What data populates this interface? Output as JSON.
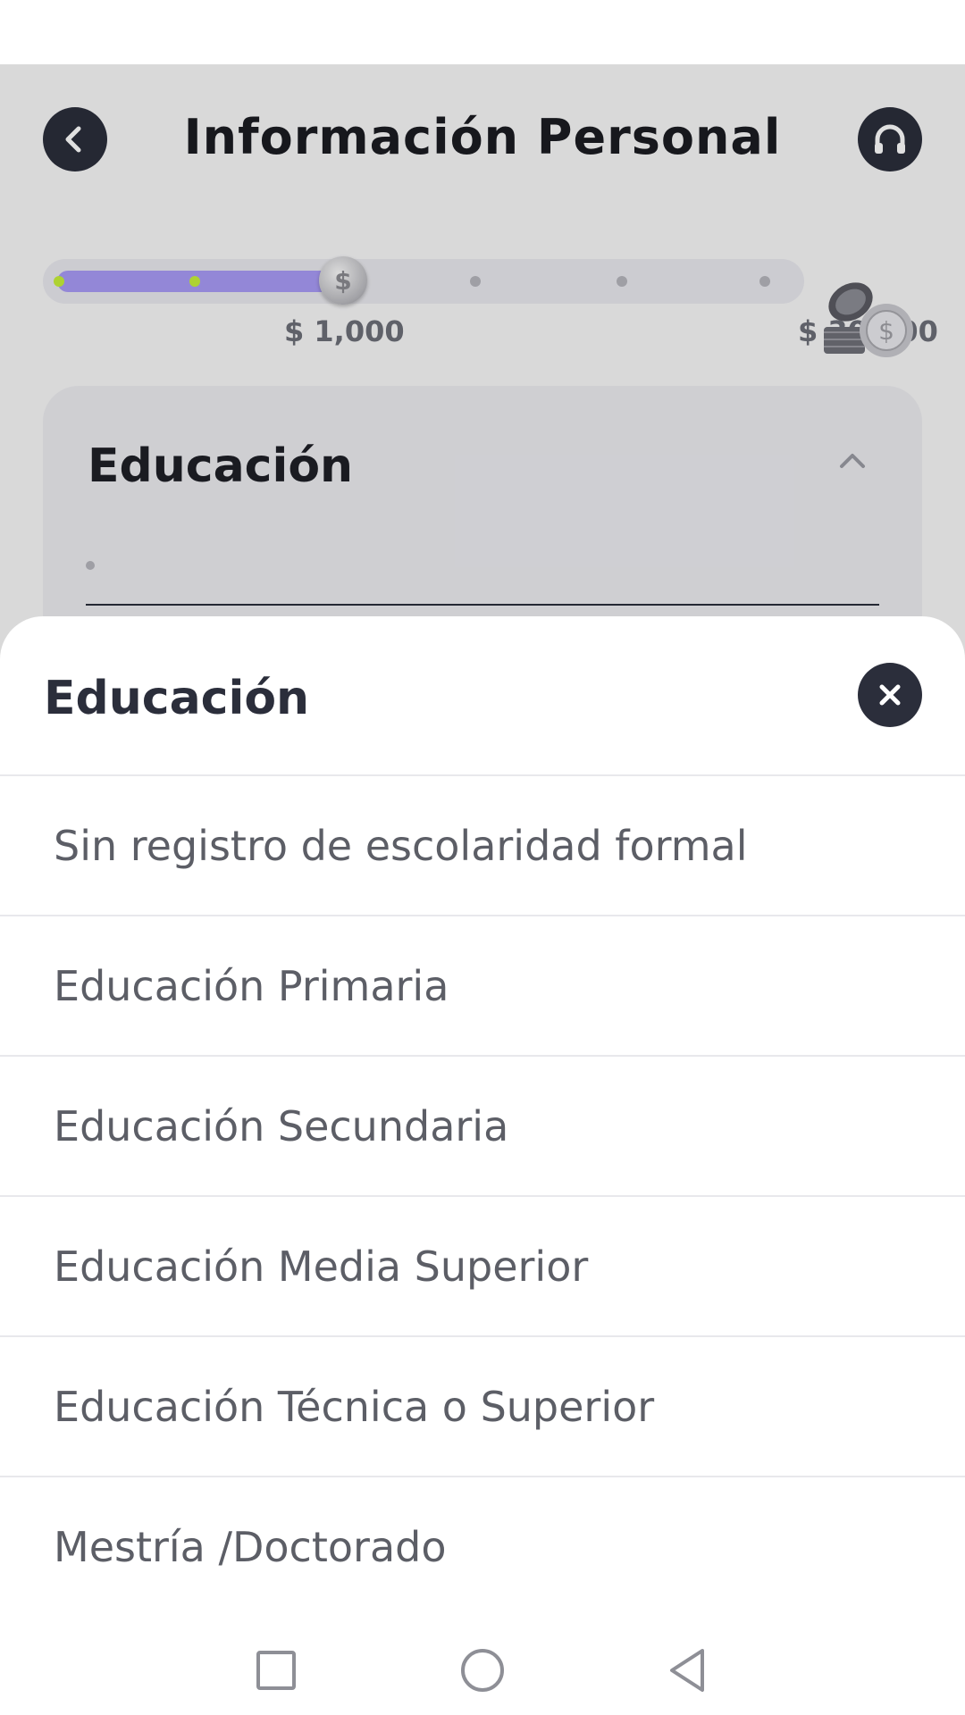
{
  "header": {
    "title": "Información Personal",
    "back_icon": "chevron-left-icon",
    "support_icon": "headset-icon"
  },
  "progress": {
    "current_amount": "$ 1,000",
    "max_amount": "$ 30,000",
    "steps_total": 6,
    "steps_completed": 2,
    "fill_fraction": 0.39,
    "fill_color": "#a89af5",
    "done_dot_color": "#c7ef3a"
  },
  "section": {
    "title": "Educación",
    "expanded": true
  },
  "sheet": {
    "title": "Educación",
    "close_icon": "close-icon",
    "options": [
      "Sin registro de escolaridad formal",
      "Educación Primaria",
      "Educación Secundaria",
      "Educación Media Superior",
      "Educación Técnica o Superior",
      "Mestría /Doctorado"
    ]
  },
  "navbar": {
    "icons": [
      "recent-apps-icon",
      "home-icon",
      "back-icon"
    ]
  },
  "colors": {
    "primary_dark": "#2b2e3b",
    "accent_purple": "#a89af5",
    "accent_lime": "#c7ef3a"
  }
}
